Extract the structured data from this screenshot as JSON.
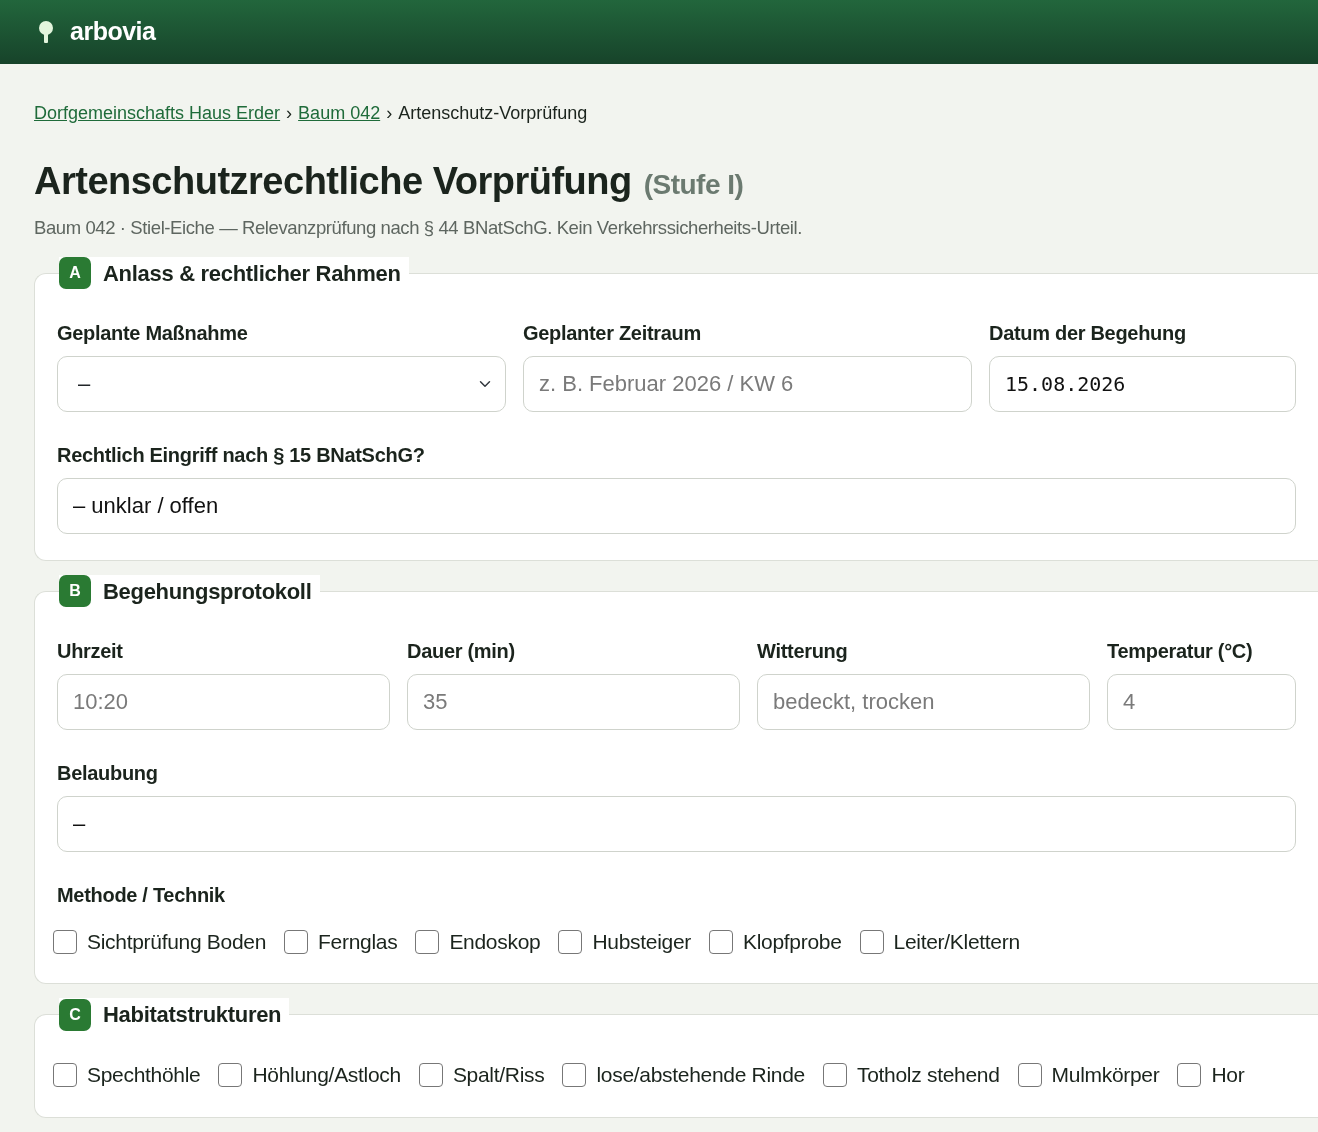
{
  "app": {
    "name": "arbovia"
  },
  "breadcrumb": [
    {
      "label": "Dorfgemeinschafts Haus Erder",
      "link": true
    },
    {
      "separator": "›",
      "label": "Baum 042",
      "link": true
    },
    {
      "separator": "›",
      "label": "Artenschutz-Vorprüfung",
      "link": false
    }
  ],
  "page": {
    "title": "Artenschutzrechtliche Vorprüfung",
    "title_suffix": "(Stufe I)",
    "subtitle": "Baum 042 · Stiel-Eiche — Relevanzprüfung nach § 44 BNatSchG. Kein Verkehrssicherheits-Urteil."
  },
  "sections": [
    {
      "letter": "A",
      "title": "Anlass & rechtlicher Rahmen",
      "rows": [
        {
          "fields": [
            {
              "kind": "select",
              "label": "Geplante Maßnahme",
              "value": "–"
            },
            {
              "kind": "text",
              "label": "Geplanter Zeitraum",
              "placeholder": "z. B. Februar 2026 / KW 6"
            },
            {
              "kind": "date",
              "label": "Datum der Begehung",
              "value": "15.08.2026"
            }
          ]
        },
        {
          "fields": [
            {
              "kind": "text",
              "label": "Rechtlich Eingriff nach § 15 BNatSchG?",
              "value": "– unklar / offen"
            }
          ]
        }
      ]
    },
    {
      "letter": "B",
      "title": "Begehungsprotokoll",
      "rows": [
        {
          "fields": [
            {
              "kind": "text",
              "label": "Uhrzeit",
              "placeholder": "10:20"
            },
            {
              "kind": "text",
              "label": "Dauer (min)",
              "placeholder": "35"
            },
            {
              "kind": "text",
              "label": "Witterung",
              "placeholder": "bedeckt, trocken"
            },
            {
              "kind": "text",
              "label": "Temperatur (°C)",
              "placeholder": "4"
            }
          ]
        },
        {
          "fields": [
            {
              "kind": "text",
              "label": "Belaubung",
              "value": "–"
            }
          ]
        },
        {
          "fields": [
            {
              "kind": "checks",
              "label": "Methode / Technik",
              "options": [
                {
                  "label": "Sichtprüfung Boden",
                  "checked": false
                },
                {
                  "label": "Fernglas",
                  "checked": false
                },
                {
                  "label": "Endoskop",
                  "checked": false
                },
                {
                  "label": "Hubsteiger",
                  "checked": false
                },
                {
                  "label": "Klopfprobe",
                  "checked": false
                },
                {
                  "label": "Leiter/Klettern",
                  "checked": false
                }
              ]
            }
          ]
        }
      ]
    },
    {
      "letter": "C",
      "title": "Habitatstrukturen",
      "rows": [
        {
          "fields": [
            {
              "kind": "checks",
              "options": [
                {
                  "label": "Spechthöhle",
                  "checked": false
                },
                {
                  "label": "Höhlung/Astloch",
                  "checked": false
                },
                {
                  "label": "Spalt/Riss",
                  "checked": false
                },
                {
                  "label": "lose/abstehende Rinde",
                  "checked": false
                },
                {
                  "label": "Totholz stehend",
                  "checked": false
                },
                {
                  "label": "Mulmkörper",
                  "checked": false
                },
                {
                  "label": "Hor",
                  "checked": false
                }
              ]
            }
          ]
        }
      ]
    }
  ]
}
